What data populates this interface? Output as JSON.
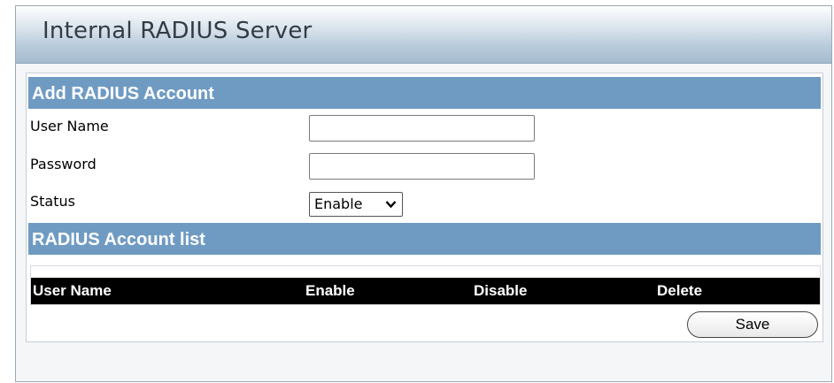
{
  "page": {
    "title": "Internal RADIUS Server"
  },
  "add_account": {
    "header": "Add RADIUS Account",
    "user_name_label": "User Name",
    "user_name_value": "",
    "password_label": "Password",
    "password_value": "",
    "status_label": "Status",
    "status_value": "Enable"
  },
  "account_list": {
    "header": "RADIUS Account list",
    "columns": [
      "User Name",
      "Enable",
      "Disable",
      "Delete"
    ],
    "rows": []
  },
  "actions": {
    "save_label": "Save"
  },
  "colors": {
    "section_header_bg": "#6f9bc3",
    "table_header_bg": "#000000"
  }
}
